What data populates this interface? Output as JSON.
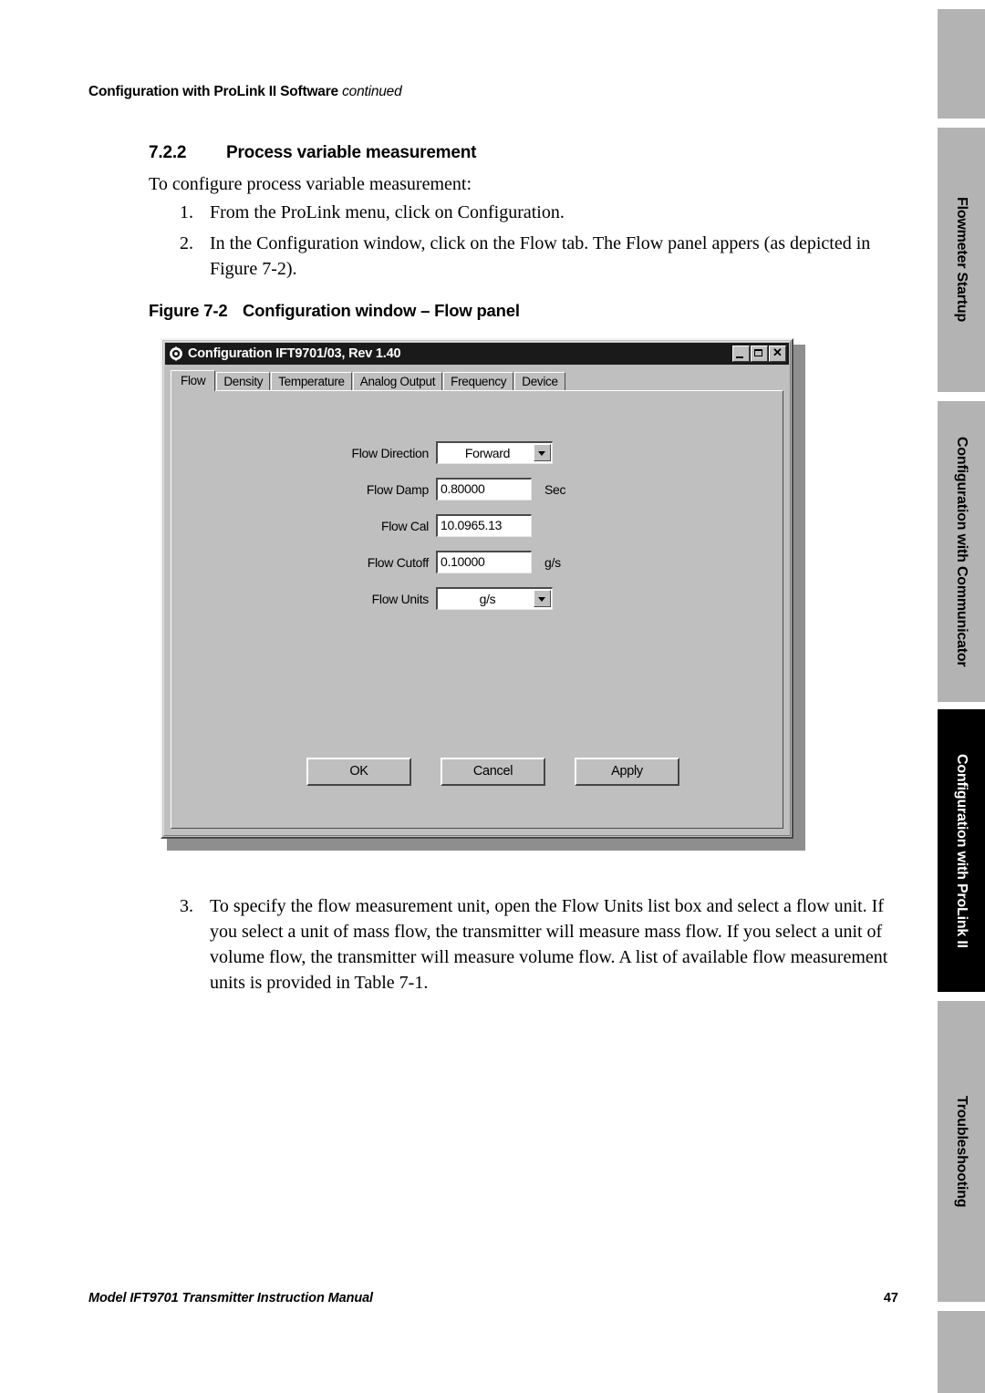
{
  "page": {
    "running_head": "Configuration with ProLink II Software",
    "running_head_continued": "continued",
    "footer_left": "Model IFT9701 Transmitter Instruction Manual",
    "footer_page_number": "47"
  },
  "section": {
    "number": "7.2.2",
    "title": "Process variable measurement",
    "lead_in": "To configure process variable measurement:",
    "steps": [
      {
        "marker": "1.",
        "text": "From the ProLink menu, click on Configuration."
      },
      {
        "marker": "2.",
        "text": "In the Configuration window, click on the Flow tab. The Flow panel appers (as depicted in Figure 7-2)."
      }
    ],
    "steps_after_figure": [
      {
        "marker": "3.",
        "text": "To specify the flow measurement unit, open the Flow Units list box and select a flow unit. If you select a unit of mass flow, the transmitter will measure mass flow. If you select a unit of volume flow, the transmitter will measure volume flow. A list of available flow measurement units is provided in Table 7-1."
      }
    ]
  },
  "figure": {
    "number": "Figure 7-2",
    "caption": "Configuration window – Flow panel"
  },
  "dialog": {
    "title": "Configuration IFT9701/03, Rev 1.40",
    "window_buttons": {
      "minimize": "minimize-button",
      "maximize": "maximize-button",
      "close": "✕"
    },
    "tabs": [
      {
        "label": "Flow",
        "active": true
      },
      {
        "label": "Density",
        "active": false
      },
      {
        "label": "Temperature",
        "active": false
      },
      {
        "label": "Analog Output",
        "active": false
      },
      {
        "label": "Frequency",
        "active": false
      },
      {
        "label": "Device",
        "active": false
      }
    ],
    "fields": [
      {
        "label": "Flow Direction",
        "type": "combo",
        "value": "Forward",
        "unit": ""
      },
      {
        "label": "Flow Damp",
        "type": "text",
        "value": "0.80000",
        "unit": "Sec"
      },
      {
        "label": "Flow Cal",
        "type": "text",
        "value": "10.0965.13",
        "unit": ""
      },
      {
        "label": "Flow Cutoff",
        "type": "text",
        "value": "0.10000",
        "unit": "g/s"
      },
      {
        "label": "Flow Units",
        "type": "combo",
        "value": "g/s",
        "unit": ""
      }
    ],
    "buttons": [
      {
        "label": "OK"
      },
      {
        "label": "Cancel"
      },
      {
        "label": "Apply"
      }
    ]
  },
  "thumb_tabs": [
    {
      "label": "",
      "active": false
    },
    {
      "label": "Flowmeter Startup",
      "active": false
    },
    {
      "label": "Configuration with Communicator",
      "active": false
    },
    {
      "label": "Configuration with ProLink II",
      "active": true
    },
    {
      "label": "Troubleshooting",
      "active": false
    },
    {
      "label": "",
      "active": false
    }
  ],
  "colors": {
    "tab_inactive": "#b3b3b3",
    "tab_active": "#000000",
    "dialog_face": "#bfbfbf",
    "titlebar": "#1a1a1a"
  }
}
